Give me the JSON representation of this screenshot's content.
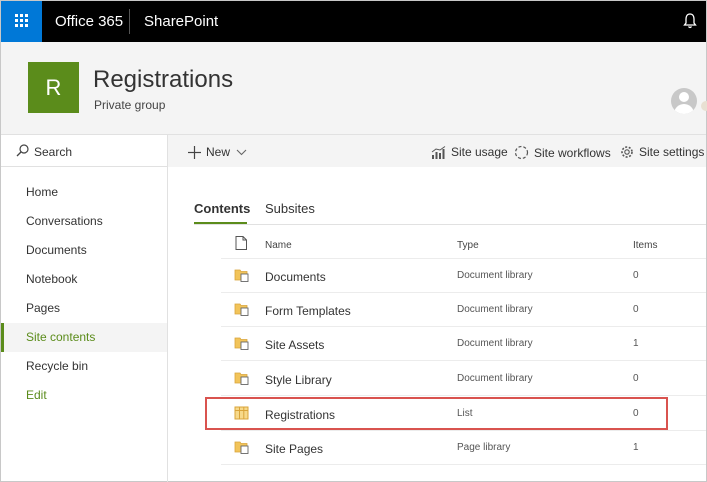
{
  "suite": {
    "brand": "Office 365",
    "app": "SharePoint"
  },
  "site": {
    "logo_letter": "R",
    "title": "Registrations",
    "subtitle": "Private group"
  },
  "search": {
    "label": "Search"
  },
  "nav": {
    "items": [
      {
        "label": "Home"
      },
      {
        "label": "Conversations"
      },
      {
        "label": "Documents"
      },
      {
        "label": "Notebook"
      },
      {
        "label": "Pages"
      },
      {
        "label": "Site contents",
        "selected": true
      },
      {
        "label": "Recycle bin"
      }
    ],
    "edit": "Edit"
  },
  "commands": {
    "new": "New",
    "site_usage": "Site usage",
    "site_workflows": "Site workflows",
    "site_settings": "Site settings"
  },
  "tabs": {
    "contents": "Contents",
    "subsites": "Subsites"
  },
  "table": {
    "headers": {
      "name": "Name",
      "type": "Type",
      "items": "Items"
    },
    "rows": [
      {
        "name": "Documents",
        "type": "Document library",
        "items": "0",
        "icon": "library-icon"
      },
      {
        "name": "Form Templates",
        "type": "Document library",
        "items": "0",
        "icon": "library-icon"
      },
      {
        "name": "Site Assets",
        "type": "Document library",
        "items": "1",
        "icon": "library-icon"
      },
      {
        "name": "Style Library",
        "type": "Document library",
        "items": "0",
        "icon": "library-icon"
      },
      {
        "name": "Registrations",
        "type": "List",
        "items": "0",
        "icon": "list-icon"
      },
      {
        "name": "Site Pages",
        "type": "Page library",
        "items": "1",
        "icon": "library-icon"
      }
    ]
  },
  "colors": {
    "accent": "#5b8c1b",
    "waffle": "#0078d7",
    "highlight": "#d9534f"
  }
}
